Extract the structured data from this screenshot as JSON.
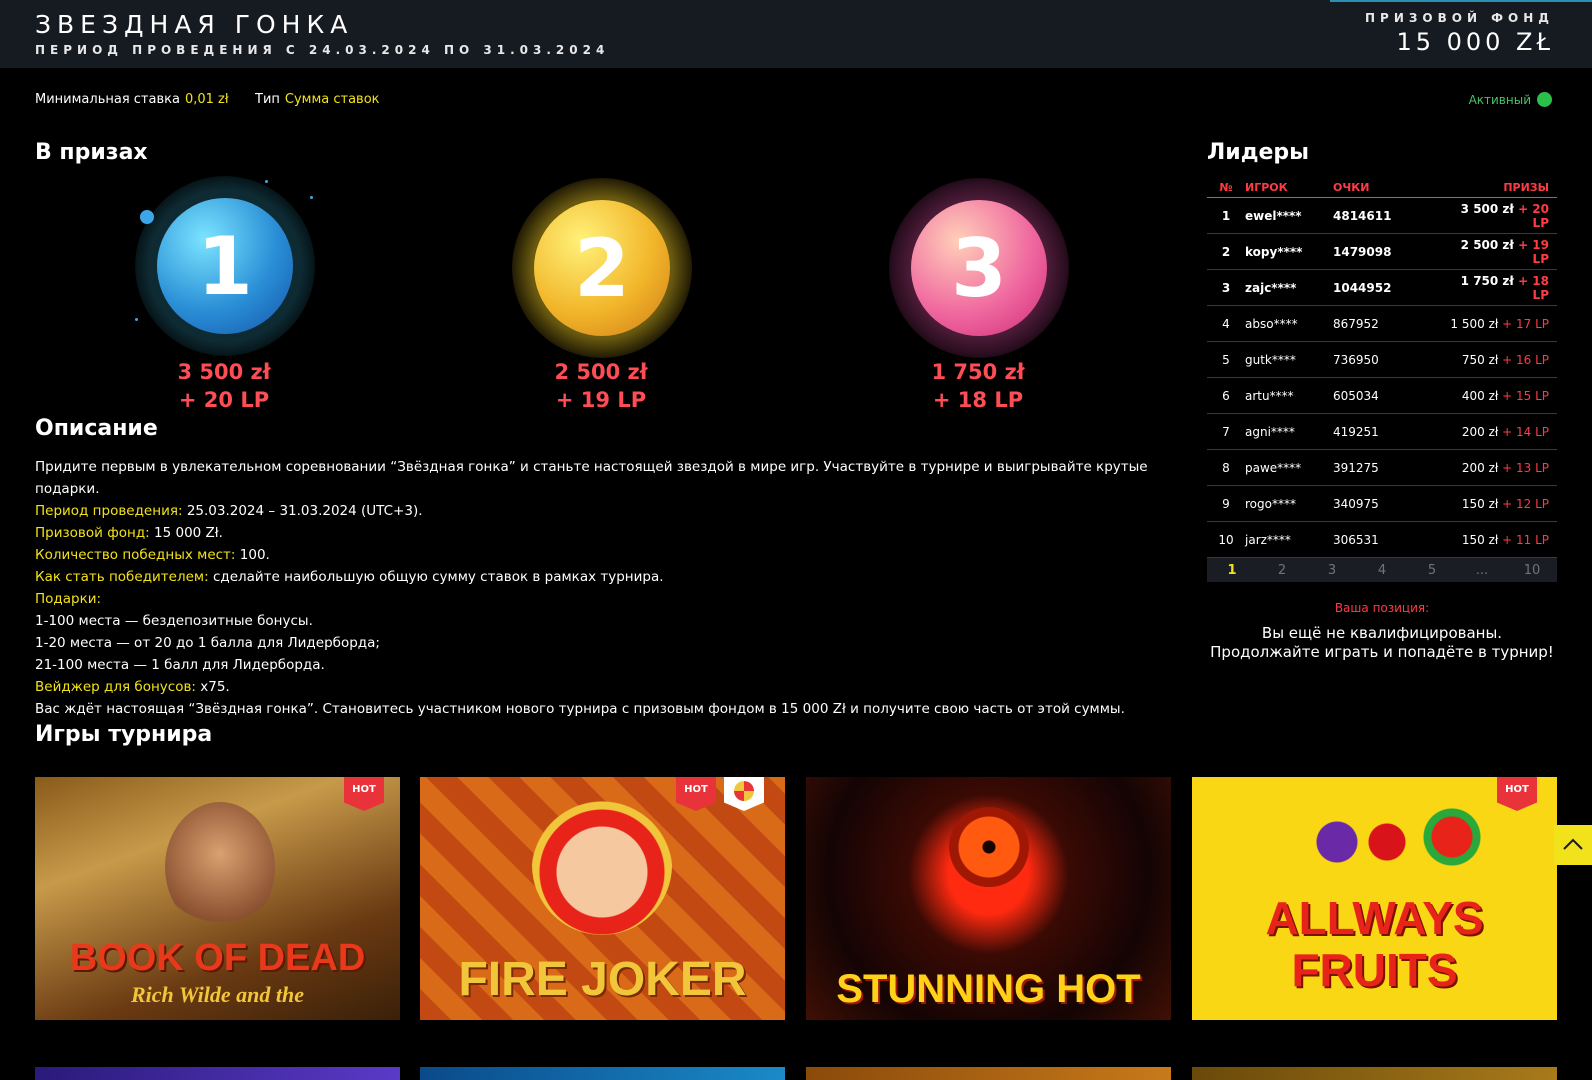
{
  "header": {
    "title": "ЗВЕЗДНАЯ ГОНКА",
    "period": "ПЕРИОД ПРОВЕДЕНИЯ С 24.03.2024 ПО 31.03.2024",
    "fund_label": "ПРИЗОВОЙ ФОНД",
    "fund_value": "15 000 ZŁ"
  },
  "meta": {
    "min_bet_label": "Минимальная ставка",
    "min_bet_value": "0,01 zł",
    "type_label": "Тип",
    "type_value": "Сумма ставок",
    "status": "Активный",
    "status_color": "#2ac04a"
  },
  "prizes": {
    "heading": "В призах",
    "items": [
      {
        "place": "1",
        "amount": "3 500 zł",
        "lp": "+ 20 LP"
      },
      {
        "place": "2",
        "amount": "2 500 zł",
        "lp": "+ 19 LP"
      },
      {
        "place": "3",
        "amount": "1 750 zł",
        "lp": "+ 18 LP"
      }
    ]
  },
  "description": {
    "heading": "Описание",
    "intro": "Придите первым в увлекательном соревновании “Звёздная гонка” и станьте настоящей звездой в мире игр. Участвуйте в турнире и выигрывайте крутые подарки.",
    "period_label": "Период проведения:",
    "period_value": "25.03.2024 – 31.03.2024 (UTC+3).",
    "fund_label": "Призовой фонд:",
    "fund_value": "15 000 Zł.",
    "places_label": "Количество победных мест:",
    "places_value": "100.",
    "how_label": "Как стать победителем:",
    "how_value": "сделайте наибольшую общую сумму ставок в рамках турнира.",
    "gifts_label": "Подарки:",
    "gift_1": "1-100 места — бездепозитные бонусы.",
    "gift_2": "1-20 места — от 20 до 1 балла для Лидерборда;",
    "gift_3": "21-100 места — 1 балл для Лидерборда.",
    "wager_label": "Вейджер для бонусов:",
    "wager_value": "x75.",
    "outro": "Вас ждёт настоящая “Звёздная гонка”. Становитесь участником нового турнира с призовым фондом в 15 000 Zł и получите свою часть от этой суммы."
  },
  "leaders": {
    "heading": "Лидеры",
    "columns": {
      "no": "№",
      "player": "ИГРОК",
      "points": "ОЧКИ",
      "prizes": "ПРИЗЫ"
    },
    "rows": [
      {
        "no": "1",
        "player": "ewel****",
        "points": "4814611",
        "prize": "3 500 zł",
        "lp": "+ 20 LP"
      },
      {
        "no": "2",
        "player": "kopy****",
        "points": "1479098",
        "prize": "2 500 zł",
        "lp": "+ 19 LP"
      },
      {
        "no": "3",
        "player": "zajc****",
        "points": "1044952",
        "prize": "1 750 zł",
        "lp": "+ 18 LP"
      },
      {
        "no": "4",
        "player": "abso****",
        "points": "867952",
        "prize": "1 500 zł",
        "lp": "+ 17 LP"
      },
      {
        "no": "5",
        "player": "gutk****",
        "points": "736950",
        "prize": "750 zł",
        "lp": "+ 16 LP"
      },
      {
        "no": "6",
        "player": "artu****",
        "points": "605034",
        "prize": "400 zł",
        "lp": "+ 15 LP"
      },
      {
        "no": "7",
        "player": "agni****",
        "points": "419251",
        "prize": "200 zł",
        "lp": "+ 14 LP"
      },
      {
        "no": "8",
        "player": "pawe****",
        "points": "391275",
        "prize": "200 zł",
        "lp": "+ 13 LP"
      },
      {
        "no": "9",
        "player": "rogo****",
        "points": "340975",
        "prize": "150 zł",
        "lp": "+ 12 LP"
      },
      {
        "no": "10",
        "player": "jarz****",
        "points": "306531",
        "prize": "150 zł",
        "lp": "+ 11 LP"
      }
    ],
    "pages": [
      "1",
      "2",
      "3",
      "4",
      "5",
      "...",
      "10"
    ],
    "your_position_label": "Ваша позиция:",
    "your_position_message": "Вы ещё не квалифицированы. Продолжайте играть и попадёте в турнир!"
  },
  "games": {
    "heading": "Игры турнира",
    "hot_label": "HOT",
    "items": [
      {
        "title": "BOOK OF DEAD",
        "subtitle": "Rich Wilde and the"
      },
      {
        "title": "FIRE JOKER"
      },
      {
        "title": "STUNNING HOT"
      },
      {
        "title": "ALLWAYS FRUITS"
      }
    ]
  },
  "icons": {
    "scroll_top": "chevron-up-icon",
    "wheel": "fortune-wheel-icon"
  },
  "colors": {
    "accent_yellow": "#f2e21b",
    "accent_red": "#ff3b44",
    "status_green": "#2ac04a"
  }
}
